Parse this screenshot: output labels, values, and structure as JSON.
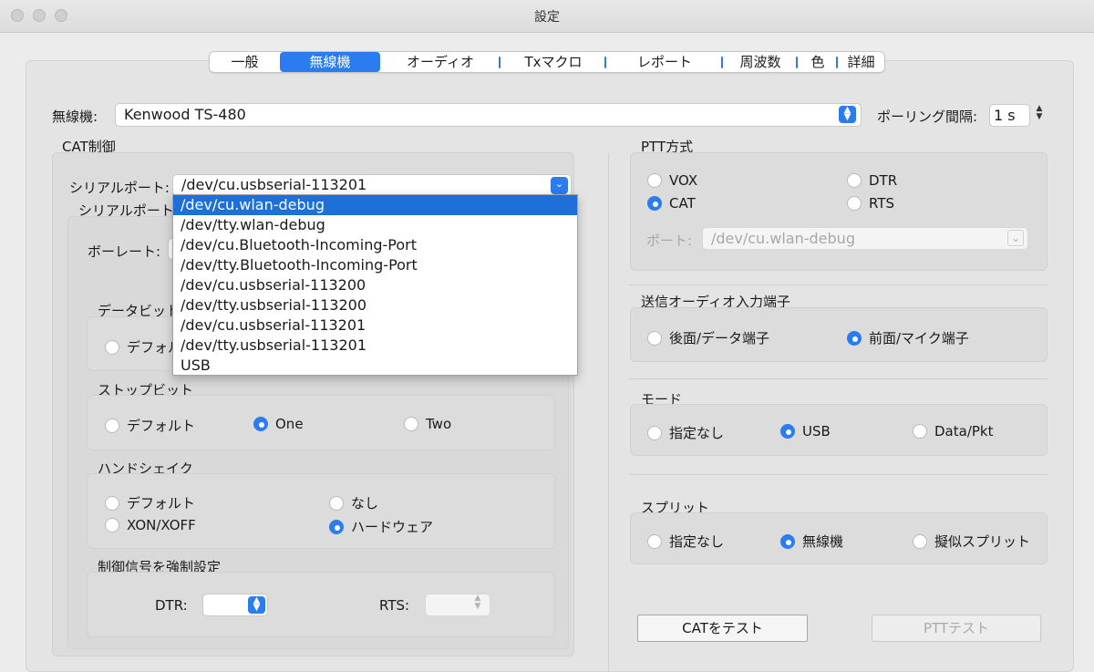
{
  "window": {
    "title": "設定"
  },
  "tabs": [
    {
      "label": "一般",
      "active": false
    },
    {
      "label": "無線機",
      "active": true
    },
    {
      "label": "オーディオ",
      "active": false
    },
    {
      "label": "Txマクロ",
      "active": false
    },
    {
      "label": "レポート",
      "active": false
    },
    {
      "label": "周波数",
      "active": false
    },
    {
      "label": "色",
      "active": false
    },
    {
      "label": "詳細",
      "active": false
    }
  ],
  "radio_row": {
    "label": "無線機:",
    "value": "Kenwood TS-480",
    "polling_label": "ポーリング間隔:",
    "polling_value": "1 s"
  },
  "cat": {
    "title": "CAT制御",
    "serial_port_label": "シリアルポート:",
    "serial_port_value": "/dev/cu.usbserial-113201",
    "serial_params_title": "シリアルポート/",
    "baud_label": "ボーレート:",
    "data_bits": {
      "title": "データビット",
      "option_default": "デフォルト"
    },
    "stop_bits": {
      "title": "ストップビット",
      "options": [
        "デフォルト",
        "One",
        "Two"
      ],
      "selected": "One"
    },
    "handshake": {
      "title": "ハンドシェイク",
      "options": [
        "デフォルト",
        "なし",
        "XON/XOFF",
        "ハードウェア"
      ],
      "selected": "ハードウェア"
    },
    "force_control": {
      "title": "制御信号を強制設定",
      "dtr_label": "DTR:",
      "rts_label": "RTS:"
    }
  },
  "port_dropdown": {
    "items": [
      "/dev/cu.wlan-debug",
      "/dev/tty.wlan-debug",
      "/dev/cu.Bluetooth-Incoming-Port",
      "/dev/tty.Bluetooth-Incoming-Port",
      "/dev/cu.usbserial-113200",
      "/dev/tty.usbserial-113200",
      "/dev/cu.usbserial-113201",
      "/dev/tty.usbserial-113201",
      "USB"
    ],
    "highlighted_index": 0
  },
  "ptt": {
    "title": "PTT方式",
    "options": [
      "VOX",
      "DTR",
      "CAT",
      "RTS"
    ],
    "selected": "CAT",
    "port_label": "ポート:",
    "port_value": "/dev/cu.wlan-debug"
  },
  "tx_audio": {
    "title": "送信オーディオ入力端子",
    "options": [
      "後面/データ端子",
      "前面/マイク端子"
    ],
    "selected": "前面/マイク端子"
  },
  "mode": {
    "title": "モード",
    "options": [
      "指定なし",
      "USB",
      "Data/Pkt"
    ],
    "selected": "USB"
  },
  "split": {
    "title": "スプリット",
    "options": [
      "指定なし",
      "無線機",
      "擬似スプリット"
    ],
    "selected": "無線機"
  },
  "buttons": {
    "test_cat": "CATをテスト",
    "test_ptt": "PTTテスト"
  },
  "colors": {
    "accent": "#2b7cf0",
    "highlight": "#1f6fd8"
  }
}
